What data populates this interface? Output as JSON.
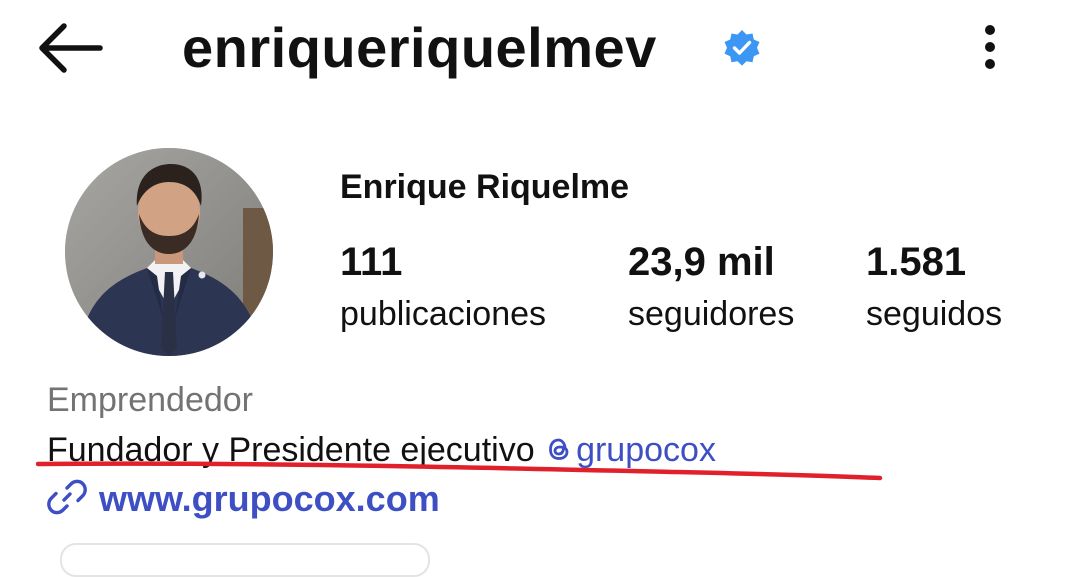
{
  "header": {
    "back_icon": "arrow-left-icon",
    "username": "enriqueriquelmev",
    "verified_icon": "verified-badge-icon",
    "more_icon": "vertical-ellipsis-icon"
  },
  "profile": {
    "display_name": "Enrique Riquelme",
    "stats": [
      {
        "value": "111",
        "label": "publicaciones"
      },
      {
        "value": "23,9 mil",
        "label": "seguidores"
      },
      {
        "value": "1.581",
        "label": "seguidos"
      }
    ]
  },
  "bio": {
    "category": "Emprendedor",
    "text": "Fundador y Presidente ejecutivo",
    "mention": "grupocox",
    "mention_icon": "threads-icon",
    "link_icon": "link-icon",
    "link": "www.grupocox.com"
  },
  "colors": {
    "accent_link": "#3e4fc4",
    "verified": "#3b97f3",
    "annotation_underline": "#e0202a",
    "secondary_text": "#737373"
  }
}
